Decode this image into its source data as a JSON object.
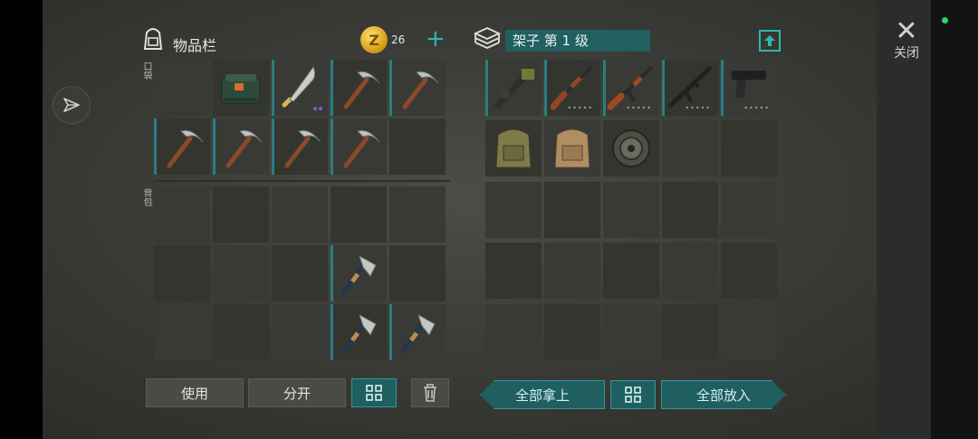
{
  "inventory": {
    "title": "物品栏",
    "coins": "26",
    "pockets_label": "口袋",
    "backpack_label": "背包"
  },
  "shelf": {
    "name": "架子 第 1 级"
  },
  "close": {
    "label": "关闭"
  },
  "buttons": {
    "use": "使用",
    "split": "分开",
    "take_all": "全部拿上",
    "put_all": "全部放入"
  },
  "pockets": [
    [
      "",
      "cooler-box",
      "machete",
      "pickaxe",
      "pickaxe"
    ],
    [
      "pickaxe",
      "pickaxe",
      "pickaxe",
      "pickaxe",
      ""
    ]
  ],
  "backpack": [
    [
      "",
      "",
      "",
      "",
      ""
    ],
    [
      "",
      "",
      "",
      "hatchet",
      ""
    ],
    [
      "",
      "",
      "",
      "hatchet",
      "hatchet"
    ]
  ],
  "shelf_items": [
    [
      "rocket-launcher",
      "shotgun",
      "ak-rifle",
      "m16-rifle",
      "pistol"
    ],
    [
      "military-backpack",
      "tan-backpack",
      "coil",
      "",
      ""
    ],
    [
      "",
      "",
      "",
      "",
      ""
    ],
    [
      "",
      "",
      "",
      "",
      ""
    ],
    [
      "",
      "",
      "",
      "",
      ""
    ]
  ],
  "colors": {
    "accent": "#2fb7b0",
    "panel": "#1f5f60",
    "quality_bar": "#2a7c86"
  }
}
